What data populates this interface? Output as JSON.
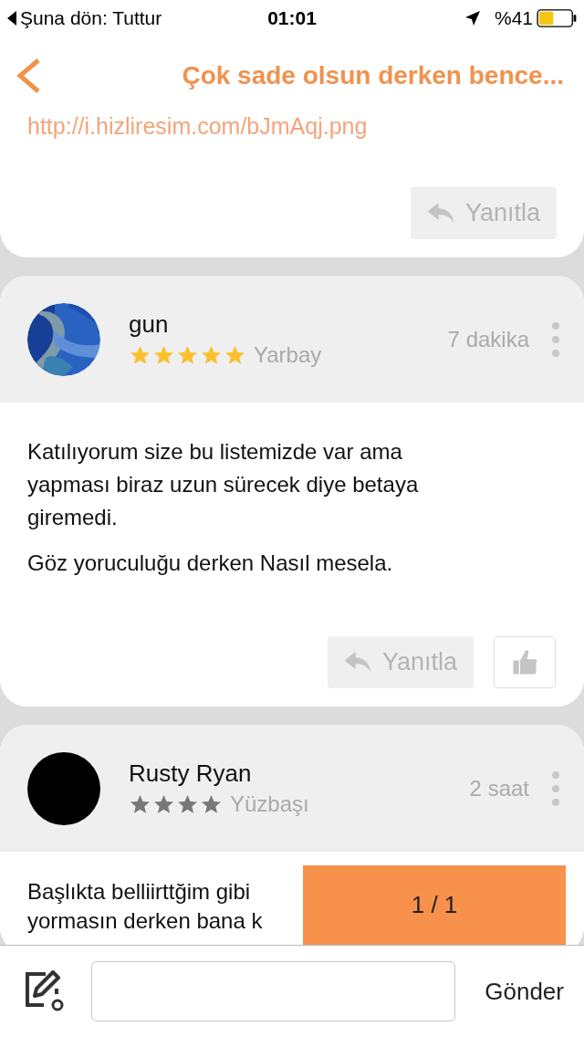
{
  "status_bar": {
    "back_label": "Şuna dön: Tuttur",
    "time": "01:01",
    "battery": "%41"
  },
  "nav": {
    "title": "Çok sade olsun derken bence..."
  },
  "comments": [
    {
      "kind": "partial",
      "link": "http://i.hizliresim.com/bJmAqj.png",
      "reply_label": "Yanıtla"
    },
    {
      "kind": "full",
      "author": "gun",
      "avatar": {
        "kind": "picture"
      },
      "stars": 5,
      "color": "#f9c12e",
      "rank": "Yarbay",
      "time": "7 dakika",
      "paragraphs": [
        "Katılıyorum size bu listemizde var ama yapması biraz uzun sürecek diye betaya giremedi.",
        "Göz yoruculuğu derken Nasıl mesela."
      ],
      "reply_label": "Yanıtla",
      "like": true
    },
    {
      "kind": "full",
      "author": "Rusty Ryan",
      "avatar": {
        "kind": "plain"
      },
      "stars": 4,
      "color": "#777777",
      "rank": "Yüzbaşı",
      "time": "2 saat",
      "lines": [
        "Başlıkta belliirttğim gibi",
        "yormasın derken bana k"
      ]
    }
  ],
  "pager": "1 / 1",
  "composer": {
    "send_label": "Gönder"
  }
}
